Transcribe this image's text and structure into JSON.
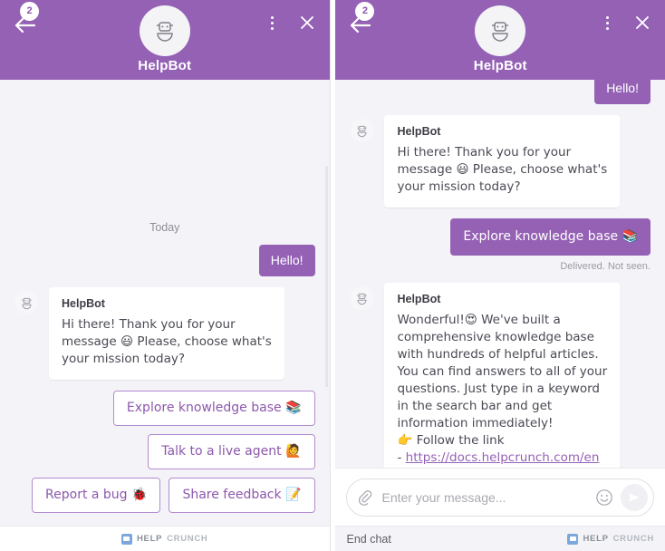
{
  "header": {
    "title": "HelpBot",
    "back_badge_count": "2",
    "back_icon": "back-arrow-icon",
    "avatar_icon": "bot-avatar-icon",
    "menu_icon": "more-options-icon",
    "close_icon": "close-icon",
    "background_color": "#9461b5"
  },
  "left_panel": {
    "day_divider": "Today",
    "messages": [
      {
        "side": "out",
        "text": "Hello!"
      },
      {
        "side": "in",
        "sender": "HelpBot",
        "text": "Hi there! Thank you for your message 😃 Please, choose what's your mission today?"
      }
    ],
    "quick_replies": [
      {
        "label": "Explore knowledge base 📚"
      },
      {
        "label": "Talk to a live agent 🙋"
      },
      {
        "label": "Report a bug 🐞"
      },
      {
        "label": "Share feedback 📝"
      }
    ],
    "footer_brand": {
      "first": "HELP",
      "second": "CRUNCH"
    }
  },
  "right_panel": {
    "messages": [
      {
        "side": "out",
        "text": "Hello!"
      },
      {
        "side": "in",
        "sender": "HelpBot",
        "text": "Hi there! Thank you for your message 😃 Please, choose what's your mission today?"
      },
      {
        "side": "out",
        "text": "Explore knowledge base 📚",
        "status": "Delivered. Not seen."
      },
      {
        "side": "in",
        "sender": "HelpBot",
        "text": "Wonderful!😍 We've built a comprehensive knowledge base with hundreds of helpful articles. You can find answers to all of your questions. Just type in a keyword in the search bar and get information immediately!\n👉 Follow the link\n- ",
        "link": "https://docs.helpcrunch.com/en"
      }
    ],
    "composer": {
      "placeholder": "Enter your message...",
      "value": "",
      "attach_icon": "paperclip-icon",
      "emoji_icon": "emoji-smiley-icon",
      "send_icon": "send-icon"
    },
    "end_chat_label": "End chat",
    "footer_brand": {
      "first": "HELP",
      "second": "CRUNCH"
    }
  }
}
